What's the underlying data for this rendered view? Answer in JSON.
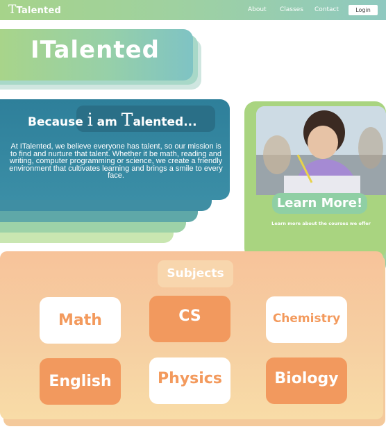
{
  "nav": {
    "logo": "Talented",
    "logo_initial": "T",
    "links": [
      "About",
      "Classes",
      "Contact"
    ],
    "login": "Login"
  },
  "hero": {
    "title": "ITalented"
  },
  "about": {
    "heading_because": "Because",
    "heading_i": "i",
    "heading_am": "am",
    "heading_t": "T",
    "heading_rest": "alented...",
    "body": "At ITalented, we believe everyone has talent, so our mission is to find and nurture that talent. Whether it be math, reading and writing, computer programming or science, we create a friendly environment that cultivates learning and brings a smile to every face."
  },
  "learn_more": {
    "button": "Learn More!",
    "subtitle": "Learn more about the courses we offer"
  },
  "subjects": {
    "title": "Subjects",
    "items": [
      {
        "label": "Math",
        "style": "white"
      },
      {
        "label": "CS",
        "style": "orange"
      },
      {
        "label": "Chemistry",
        "style": "white"
      },
      {
        "label": "English",
        "style": "orange"
      },
      {
        "label": "Physics",
        "style": "white"
      },
      {
        "label": "Biology",
        "style": "orange"
      }
    ]
  },
  "colors": {
    "green": "#a9d480",
    "teal": "#2e7f9a",
    "orange": "#f2995e",
    "peach": "#f7c39a"
  }
}
